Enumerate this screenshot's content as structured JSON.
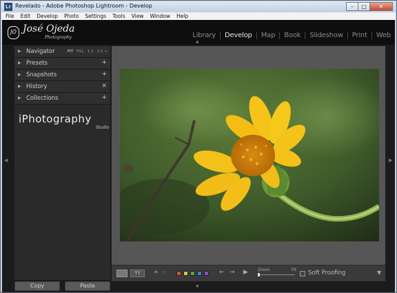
{
  "window": {
    "title": "Revelado - Adobe Photoshop Lightroom - Develop",
    "app_icon": "Lr",
    "controls": {
      "minimize": "–",
      "maximize": "□",
      "close": "✕"
    }
  },
  "menubar": [
    "File",
    "Edit",
    "Develop",
    "Photo",
    "Settings",
    "Tools",
    "View",
    "Window",
    "Help"
  ],
  "identity": {
    "name": "José",
    "name2": "Ojeda",
    "sub": "Photography",
    "mark": "JO"
  },
  "modules": [
    {
      "label": "Library",
      "active": false
    },
    {
      "label": "Develop",
      "active": true
    },
    {
      "label": "Map",
      "active": false
    },
    {
      "label": "Book",
      "active": false
    },
    {
      "label": "Slideshow",
      "active": false
    },
    {
      "label": "Print",
      "active": false
    },
    {
      "label": "Web",
      "active": false
    }
  ],
  "left_panel": {
    "navigator": {
      "label": "Navigator",
      "options": [
        "FIT",
        "FILL",
        "1:1",
        "2:1 ÷"
      ]
    },
    "presets": {
      "label": "Presets",
      "action": "+"
    },
    "snapshots": {
      "label": "Snapshots",
      "action": "+"
    },
    "history": {
      "label": "History",
      "action": "×"
    },
    "collections": {
      "label": "Collections",
      "action": "+"
    },
    "brand": {
      "text": "iPhotography",
      "sub": "Studio"
    }
  },
  "footer": {
    "copy": "Copy",
    "paste": "Paste"
  },
  "toolbar": {
    "yy_label": "YY",
    "zoom_label": "Zoom",
    "zoom_fit": "Fit",
    "soft_proofing": "Soft Proofing",
    "color_labels": [
      "#d84a3a",
      "#d8c33a",
      "#55a844",
      "#3f7fd0",
      "#8a4cc2"
    ]
  },
  "icons": {
    "triangle": "▶",
    "flag_pick": "⚑",
    "flag_reject": "⚐",
    "prev": "←",
    "next": "→",
    "play": "▶",
    "menu": "▼",
    "arrow_up": "▲",
    "arrow_down": "▼",
    "arrow_left": "◀",
    "arrow_right": "▶"
  }
}
